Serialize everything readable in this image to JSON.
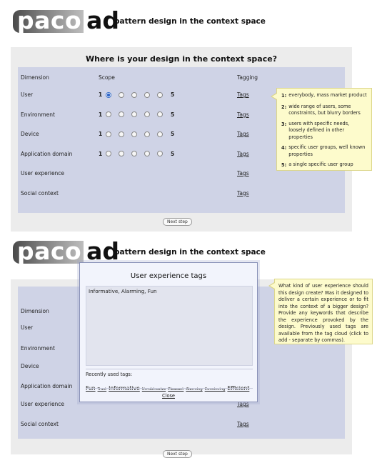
{
  "logo": {
    "left_text": "paco",
    "right_text": "ad"
  },
  "tagline": "pattern design in the context space",
  "screen1": {
    "heading": "Where is your design in the context space?",
    "headers": {
      "dimension": "Dimension",
      "scope": "Scope",
      "tagging": "Tagging"
    },
    "rows": [
      {
        "label": "User",
        "tag": "Tags",
        "has_scope": true,
        "selected": 1
      },
      {
        "label": "Environment",
        "tag": "Tags",
        "has_scope": true,
        "selected": 0
      },
      {
        "label": "Device",
        "tag": "Tags",
        "has_scope": true,
        "selected": 0
      },
      {
        "label": "Application domain",
        "tag": "Tags",
        "has_scope": true,
        "selected": 0
      },
      {
        "label": "User experience",
        "tag": "Tags",
        "has_scope": false
      },
      {
        "label": "Social context",
        "tag": "Tags",
        "has_scope": false
      }
    ],
    "scale_min": "1",
    "scale_max": "5",
    "next_button": "Next step",
    "legend": [
      {
        "num": "1:",
        "text": "everybody, mass market product"
      },
      {
        "num": "2:",
        "text": "wide range of users, some constraints, but blurry borders"
      },
      {
        "num": "3:",
        "text": "users with specific needs, loosely defined in other properties"
      },
      {
        "num": "4:",
        "text": "specific user groups, well known properties"
      },
      {
        "num": "5:",
        "text": "a single specific user group"
      }
    ]
  },
  "screen2": {
    "labels": [
      "Dimension",
      "User",
      "Environment",
      "Device",
      "Application domain",
      "User experience",
      "Social context"
    ],
    "tags": [
      "Tags",
      "Tags"
    ],
    "next_button": "Next step",
    "help_text": "What kind of user experience should this design create? Was it designed to deliver a certain experience or to fit into the context of a bigger design? Provide any keywords that describe the experience provoked by the design. Previously used tags are available from the tag cloud (click to add - separate by commas).",
    "dialog": {
      "title": "User experience tags",
      "value": "Informative, Alarming, Fun",
      "recent_label": "Recently used tags:",
      "cloud": [
        {
          "text": "Fun",
          "weight": "l"
        },
        {
          "text": "Trust",
          "weight": "s"
        },
        {
          "text": "Informative",
          "weight": "l"
        },
        {
          "text": "Un-obtrusive",
          "weight": "s"
        },
        {
          "text": "Pleasant",
          "weight": "s"
        },
        {
          "text": "Alarming",
          "weight": "s"
        },
        {
          "text": "Convincing",
          "weight": "s"
        },
        {
          "text": "Efficient",
          "weight": "l"
        }
      ],
      "close": "Close"
    }
  }
}
